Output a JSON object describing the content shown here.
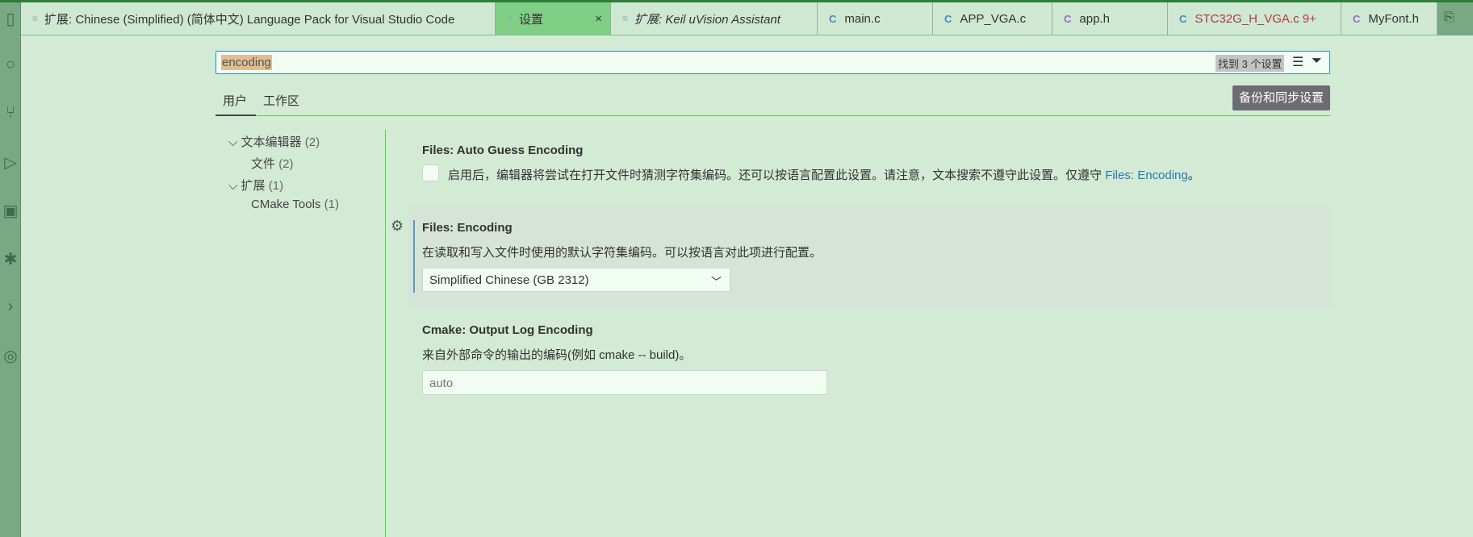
{
  "tabs": [
    {
      "label": "扩展: Chinese (Simplified) (简体中文) Language Pack for Visual Studio Code",
      "icon": "doc"
    },
    {
      "label": "设置",
      "icon": "doc",
      "active": true,
      "close": "×"
    },
    {
      "label": "扩展: Keil uVision Assistant",
      "icon": "doc"
    },
    {
      "label": "main.c",
      "icon": "C"
    },
    {
      "label": "APP_VGA.c",
      "icon": "C"
    },
    {
      "label": "app.h",
      "icon": "C"
    },
    {
      "label": "STC32G_H_VGA.c",
      "badge": "9+",
      "icon": "C"
    },
    {
      "label": "MyFont.h",
      "icon": "C"
    }
  ],
  "search": {
    "value": "encoding",
    "result_count": "找到 3 个设置"
  },
  "scope_tabs": [
    "用户",
    "工作区"
  ],
  "sync_button": "备份和同步设置",
  "toc": [
    {
      "label": "文本编辑器",
      "count": "(2)"
    },
    {
      "label": "文件",
      "count": "(2)"
    },
    {
      "label": "扩展",
      "count": "(1)"
    },
    {
      "label": "CMake Tools",
      "count": "(1)"
    }
  ],
  "settings": [
    {
      "title": "Files: Auto Guess Encoding",
      "desc": "启用后，编辑器将尝试在打开文件时猜测字符集编码。还可以按语言配置此设置。请注意，文本搜索不遵守此设置。仅遵守 ",
      "link": "Files: Encoding",
      "desc_end": "。",
      "checked": false
    },
    {
      "title": "Files: Encoding",
      "desc": "在读取和写入文件时使用的默认字符集编码。可以按语言对此项进行配置。",
      "value": "Simplified Chinese (GB 2312)"
    },
    {
      "title": "Cmake: Output Log Encoding",
      "desc": "来自外部命令的输出的编码(例如 cmake -- build)。",
      "value": "auto"
    }
  ],
  "colors": {
    "accent": "#4fd24f",
    "activity_bar": "#78a982",
    "link": "#2a78b8"
  }
}
